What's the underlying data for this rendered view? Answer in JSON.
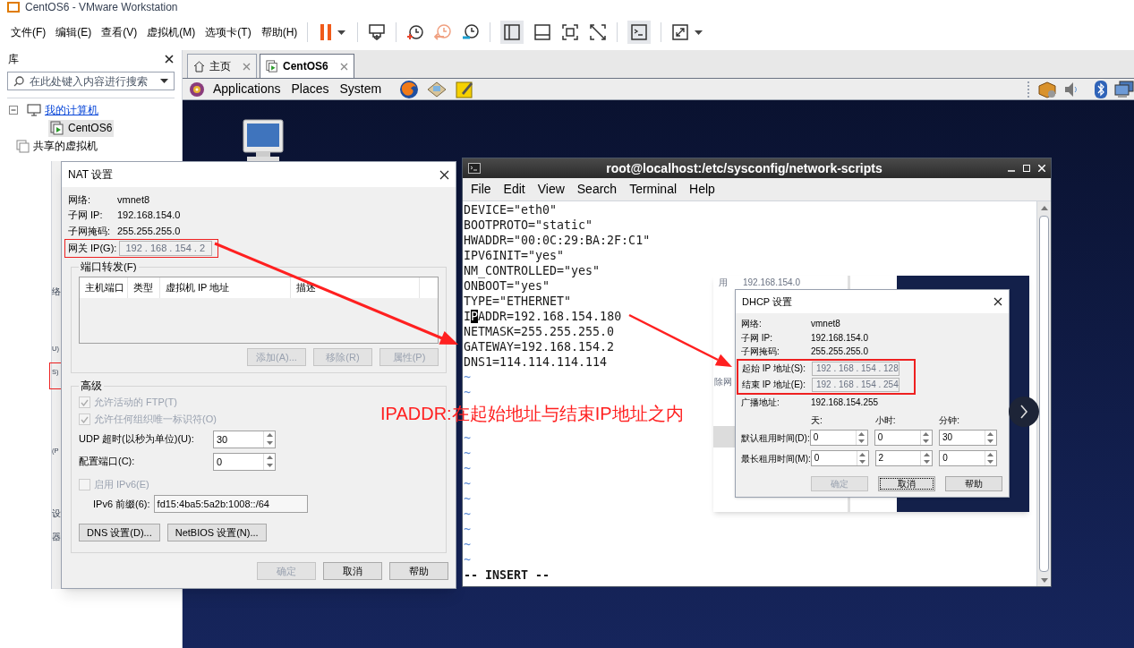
{
  "app": {
    "title": "CentOS6 - VMware Workstation",
    "menus": [
      "文件(F)",
      "编辑(E)",
      "查看(V)",
      "虚拟机(M)",
      "选项卡(T)",
      "帮助(H)"
    ]
  },
  "library": {
    "title": "库",
    "search": {
      "placeholder": "在此处键入内容进行搜索"
    },
    "tree": [
      {
        "label": "我的计算机",
        "hovered": true,
        "selected": false,
        "expanded": true,
        "children": [
          {
            "label": "CentOS6",
            "hovered": false,
            "selected": true
          }
        ]
      },
      {
        "label": "共享的虚拟机",
        "hovered": false,
        "selected": false
      }
    ]
  },
  "tabs": [
    {
      "label": "主页",
      "selected": false
    },
    {
      "label": "CentOS6",
      "selected": true
    }
  ],
  "guest_panel": {
    "menus": [
      "Applications",
      "Places",
      "System"
    ]
  },
  "behind_window_fragments": [
    {
      "text": "络"
    },
    {
      "text": "U)"
    },
    {
      "text": "S)"
    },
    {
      "text": "(P"
    },
    {
      "text": "设"
    },
    {
      "text": "器"
    }
  ],
  "nat_dialog": {
    "title": "NAT 设置",
    "info": [
      {
        "label": "网络:",
        "value": "vmnet8"
      },
      {
        "label": "子网 IP:",
        "value": "192.168.154.0"
      },
      {
        "label": "子网掩码:",
        "value": "255.255.255.0"
      }
    ],
    "gateway": {
      "label": "网关 IP(G):",
      "value": "192 . 168 . 154 . 2",
      "disabled": true
    },
    "port_forwarding": {
      "title": "端口转发(F)",
      "columns": [
        "主机端口",
        "类型",
        "虚拟机 IP 地址",
        "描述"
      ],
      "buttons": [
        {
          "label": "添加(A)...",
          "disabled": true
        },
        {
          "label": "移除(R)",
          "disabled": true
        },
        {
          "label": "属性(P)",
          "disabled": true
        }
      ]
    },
    "advanced": {
      "title": "高级",
      "options": [
        {
          "kind": "checkbox",
          "label": "允许活动的 FTP(T)",
          "checked": true,
          "disabled": true
        },
        {
          "kind": "checkbox",
          "label": "允许任何组织唯一标识符(O)",
          "checked": true,
          "disabled": true
        },
        {
          "kind": "spin",
          "label": "UDP 超时(以秒为单位)(U):",
          "value": "30"
        },
        {
          "kind": "spin",
          "label": "配置端口(C):",
          "value": "0"
        },
        {
          "kind": "checkbox",
          "label": "启用 IPv6(E)",
          "checked": false,
          "disabled": true
        },
        {
          "kind": "text",
          "label": "IPv6 前缀(6):",
          "value": "fd15:4ba5:5a2b:1008::/64"
        }
      ],
      "buttons": [
        {
          "label": "DNS 设置(D)...",
          "disabled": false
        },
        {
          "label": "NetBIOS 设置(N)...",
          "disabled": false
        }
      ]
    },
    "buttons": [
      {
        "label": "确定",
        "disabled": true
      },
      {
        "label": "取消",
        "disabled": false
      },
      {
        "label": "帮助",
        "disabled": false
      }
    ]
  },
  "terminal": {
    "title": "root@localhost:/etc/sysconfig/network-scripts",
    "menus": [
      "File",
      "Edit",
      "View",
      "Search",
      "Terminal",
      "Help"
    ],
    "lines": [
      {
        "kind": "text",
        "text": "DEVICE=\"eth0\""
      },
      {
        "kind": "text",
        "text": "BOOTPROTO=\"static\""
      },
      {
        "kind": "text",
        "text": "HWADDR=\"00:0C:29:BA:2F:C1\""
      },
      {
        "kind": "text",
        "text": "IPV6INIT=\"yes\""
      },
      {
        "kind": "text",
        "text": "NM_CONTROLLED=\"yes\""
      },
      {
        "kind": "text",
        "text": "ONBOOT=\"yes\""
      },
      {
        "kind": "text",
        "text": "TYPE=\"ETHERNET\""
      },
      {
        "kind": "cursor",
        "before": "I",
        "cursor": "P",
        "after": "ADDR=192.168.154.180"
      },
      {
        "kind": "text",
        "text": "NETMASK=255.255.255.0"
      },
      {
        "kind": "text",
        "text": "GATEWAY=192.168.154.2"
      },
      {
        "kind": "text",
        "text": "DNS1=114.114.114.114"
      },
      {
        "kind": "tilde",
        "text": "~"
      },
      {
        "kind": "tilde",
        "text": "~"
      },
      {
        "kind": "covered"
      },
      {
        "kind": "covered"
      },
      {
        "kind": "tilde",
        "text": "~"
      },
      {
        "kind": "tilde",
        "text": "~"
      },
      {
        "kind": "tilde",
        "text": "~"
      },
      {
        "kind": "tilde",
        "text": "~"
      },
      {
        "kind": "tilde",
        "text": "~"
      },
      {
        "kind": "tilde",
        "text": "~"
      },
      {
        "kind": "tilde",
        "text": "~"
      },
      {
        "kind": "tilde",
        "text": "~"
      },
      {
        "kind": "tilde",
        "text": "~"
      }
    ],
    "mode": "-- INSERT --"
  },
  "dhcp_inset": {
    "behind_fragments": [
      {
        "text": "用"
      },
      {
        "text": "192.168.154.0"
      },
      {
        "text": "除网"
      }
    ],
    "dialog": {
      "title": "DHCP 设置",
      "info": [
        {
          "label": "网络:",
          "value": "vmnet8"
        },
        {
          "label": "子网 IP:",
          "value": "192.168.154.0"
        },
        {
          "label": "子网掩码:",
          "value": "255.255.255.0"
        }
      ],
      "range": [
        {
          "label": "起始 IP 地址(S):",
          "value": "192 . 168 . 154 . 128"
        },
        {
          "label": "结束 IP 地址(E):",
          "value": "192 . 168 . 154 . 254"
        }
      ],
      "broadcast": {
        "label": "广播地址:",
        "value": "192.168.154.255"
      },
      "lease": {
        "columns": [
          "天:",
          "小时:",
          "分钟:"
        ],
        "rows": [
          {
            "label": "默认租用时间(D):",
            "values": [
              "0",
              "0",
              "30"
            ]
          },
          {
            "label": "最长租用时间(M):",
            "values": [
              "0",
              "2",
              "0"
            ]
          }
        ]
      },
      "buttons": [
        {
          "label": "确定",
          "disabled": true,
          "focused": false
        },
        {
          "label": "取消",
          "disabled": false,
          "focused": true
        },
        {
          "label": "帮助",
          "disabled": false,
          "focused": false
        }
      ]
    }
  },
  "annotation": "IPADDR:在起始地址与结束IP地址之内"
}
